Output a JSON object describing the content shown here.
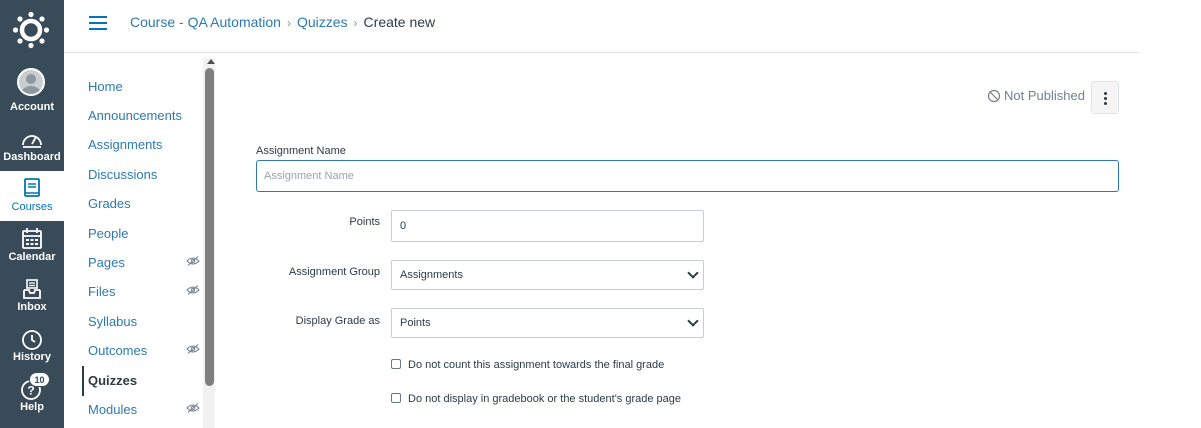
{
  "global_nav": {
    "items": [
      {
        "label": "Account",
        "icon": "avatar"
      },
      {
        "label": "Dashboard",
        "icon": "dashboard-icon"
      },
      {
        "label": "Courses",
        "icon": "book-icon"
      },
      {
        "label": "Calendar",
        "icon": "calendar-icon"
      },
      {
        "label": "Inbox",
        "icon": "inbox-icon"
      },
      {
        "label": "History",
        "icon": "clock-icon"
      },
      {
        "label": "Help",
        "icon": "help-icon"
      }
    ],
    "help_badge": "10",
    "active_color": "#0374b5",
    "background": "#394b58"
  },
  "breadcrumb": {
    "course": "Course - QA Automation",
    "section": "Quizzes",
    "current": "Create new",
    "separator": "›"
  },
  "course_nav": {
    "items": [
      {
        "label": "Home"
      },
      {
        "label": "Announcements"
      },
      {
        "label": "Assignments"
      },
      {
        "label": "Discussions"
      },
      {
        "label": "Grades"
      },
      {
        "label": "People"
      },
      {
        "label": "Pages",
        "hidden": true
      },
      {
        "label": "Files",
        "hidden": true
      },
      {
        "label": "Syllabus"
      },
      {
        "label": "Outcomes",
        "hidden": true
      },
      {
        "label": "Quizzes",
        "active": true
      },
      {
        "label": "Modules",
        "hidden": true
      }
    ]
  },
  "status": {
    "publish_label": "Not Published"
  },
  "form": {
    "assignment_name_label": "Assignment Name",
    "assignment_name_placeholder": "Assignment Name",
    "points_label": "Points",
    "points_value": "0",
    "group_label": "Assignment Group",
    "group_value": "Assignments",
    "display_grade_label": "Display Grade as",
    "display_grade_value": "Points",
    "no_count_label": "Do not count this assignment towards the final grade",
    "no_display_label": "Do not display in gradebook or the student's grade page"
  }
}
